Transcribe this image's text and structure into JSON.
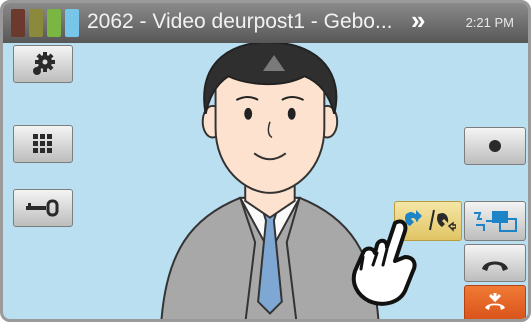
{
  "status_bar": {
    "title": "2062 - Video deurpost1 - Gebo...",
    "time": "2:21 PM",
    "more_icon": "chevron-double-right-icon"
  },
  "buttons": {
    "settings_icon": "gear-icon",
    "keypad_icon": "grid-keypad-icon",
    "door_release_icon": "key-icon",
    "record_icon": "record-dot-icon",
    "transfer_icon": "call-transfer-icon",
    "monitor_switch_icon": "camera-switch-icon",
    "answer_icon": "handset-icon",
    "hangup_icon": "end-call-icon",
    "pan_up_icon": "triangle-up-icon"
  },
  "colors": {
    "background": "#b9dff0",
    "status_bar": "#6a6a6a",
    "transfer_highlight": "#e9d27a",
    "hangup": "#e0601f",
    "accent_blue": "#1e84c8"
  }
}
